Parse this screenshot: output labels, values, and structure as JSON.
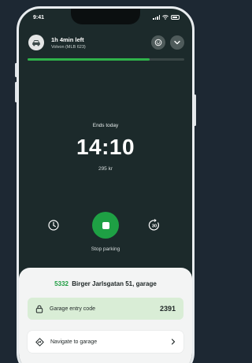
{
  "status_bar": {
    "time": "9:41"
  },
  "session": {
    "time_left": "1h 4min left",
    "vehicle": "Volvon (MLB 623)",
    "progress_fraction": 0.78,
    "ends_label": "Ends today",
    "end_time": "14:10",
    "price": "295 kr",
    "extend_badge": "30"
  },
  "controls": {
    "stop_label": "Stop parking"
  },
  "zone": {
    "code": "5332",
    "address": "Birger Jarlsgatan 51, garage"
  },
  "garage_code": {
    "label": "Garage entry code",
    "value": "2391"
  },
  "navigate": {
    "label": "Navigate to garage"
  },
  "colors": {
    "background": "#1d2833",
    "screen": "#1c2a2b",
    "accent_green": "#1ea044",
    "progress_green": "#2fb24a",
    "code_card": "#d9edd6"
  }
}
